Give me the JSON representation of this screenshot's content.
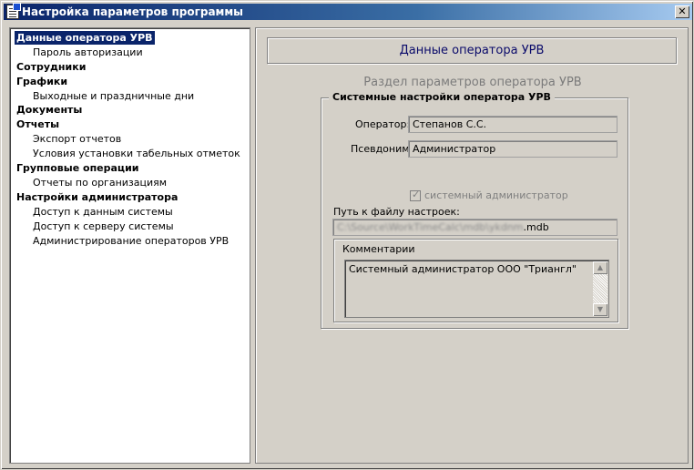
{
  "window": {
    "title": "Настройка параметров программы",
    "close_label": "✕"
  },
  "tree": {
    "items": [
      {
        "label": "Данные оператора УРВ",
        "level": 0,
        "selected": true
      },
      {
        "label": "Пароль авторизации",
        "level": 1
      },
      {
        "label": "Сотрудники",
        "level": 0
      },
      {
        "label": "Графики",
        "level": 0
      },
      {
        "label": "Выходные и праздничные дни",
        "level": 1
      },
      {
        "label": "Документы",
        "level": 0
      },
      {
        "label": "Отчеты",
        "level": 0
      },
      {
        "label": "Экспорт отчетов",
        "level": 1
      },
      {
        "label": "Условия установки табельных отметок",
        "level": 1
      },
      {
        "label": "Групповые операции",
        "level": 0
      },
      {
        "label": "Отчеты по организациям",
        "level": 1
      },
      {
        "label": "Настройки администратора",
        "level": 0
      },
      {
        "label": "Доступ к данным системы",
        "level": 1
      },
      {
        "label": "Доступ к серверу системы",
        "level": 1
      },
      {
        "label": "Администрирование операторов УРВ",
        "level": 1
      }
    ]
  },
  "panel": {
    "header": "Данные оператора УРВ",
    "subtitle": "Раздел параметров оператора УРВ",
    "group_title": "Системные настройки оператора УРВ",
    "operator_label": "Оператор:",
    "operator_value": "Степанов С.С.",
    "alias_label": "Псевдоним:",
    "alias_value": "Администратор",
    "sysadmin_checkbox_label": "системный администратор",
    "sysadmin_checked": true,
    "path_label": "Путь к файлу настроек:",
    "path_value_blurred": "C:\\Source\\WorkTimeCalc\\mdb\\ykdnm",
    "path_value_ext": ".mdb",
    "comments_label": "Комментарии",
    "comments_text": "Системный администратор ООО \"Триангл\""
  },
  "colors": {
    "titlebar": "#0a246a",
    "selection": "#0a246a",
    "header_text": "#0a0a6a",
    "window_bg": "#d4d0c8"
  }
}
